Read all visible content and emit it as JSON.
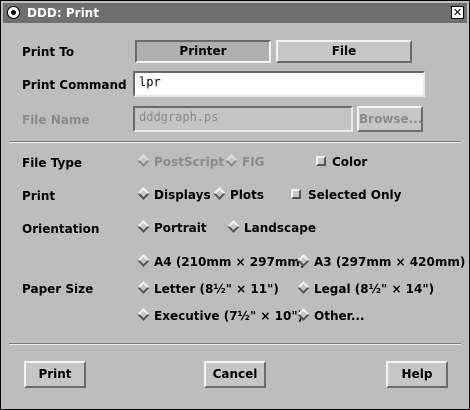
{
  "window": {
    "title": "DDD: Print"
  },
  "print_to": {
    "label": "Print To",
    "printer": "Printer",
    "file": "File"
  },
  "print_command": {
    "label": "Print Command",
    "value": "lpr"
  },
  "file_name": {
    "label": "File Name",
    "value": "dddgraph.ps",
    "browse": "Browse..."
  },
  "file_type": {
    "label": "File Type",
    "postscript": "PostScript",
    "fig": "FIG",
    "color": "Color"
  },
  "print": {
    "label": "Print",
    "displays": "Displays",
    "plots": "Plots",
    "selected_only": "Selected Only"
  },
  "orientation": {
    "label": "Orientation",
    "portrait": "Portrait",
    "landscape": "Landscape"
  },
  "paper_size": {
    "label": "Paper Size",
    "a4": "A4 (210mm × 297mm)",
    "a3": "A3 (297mm × 420mm)",
    "letter": "Letter (8½\" × 11\")",
    "legal": "Legal (8½\" × 14\")",
    "executive": "Executive (7½\" × 10\")",
    "other": "Other..."
  },
  "buttons": {
    "print": "Print",
    "cancel": "Cancel",
    "help": "Help"
  }
}
